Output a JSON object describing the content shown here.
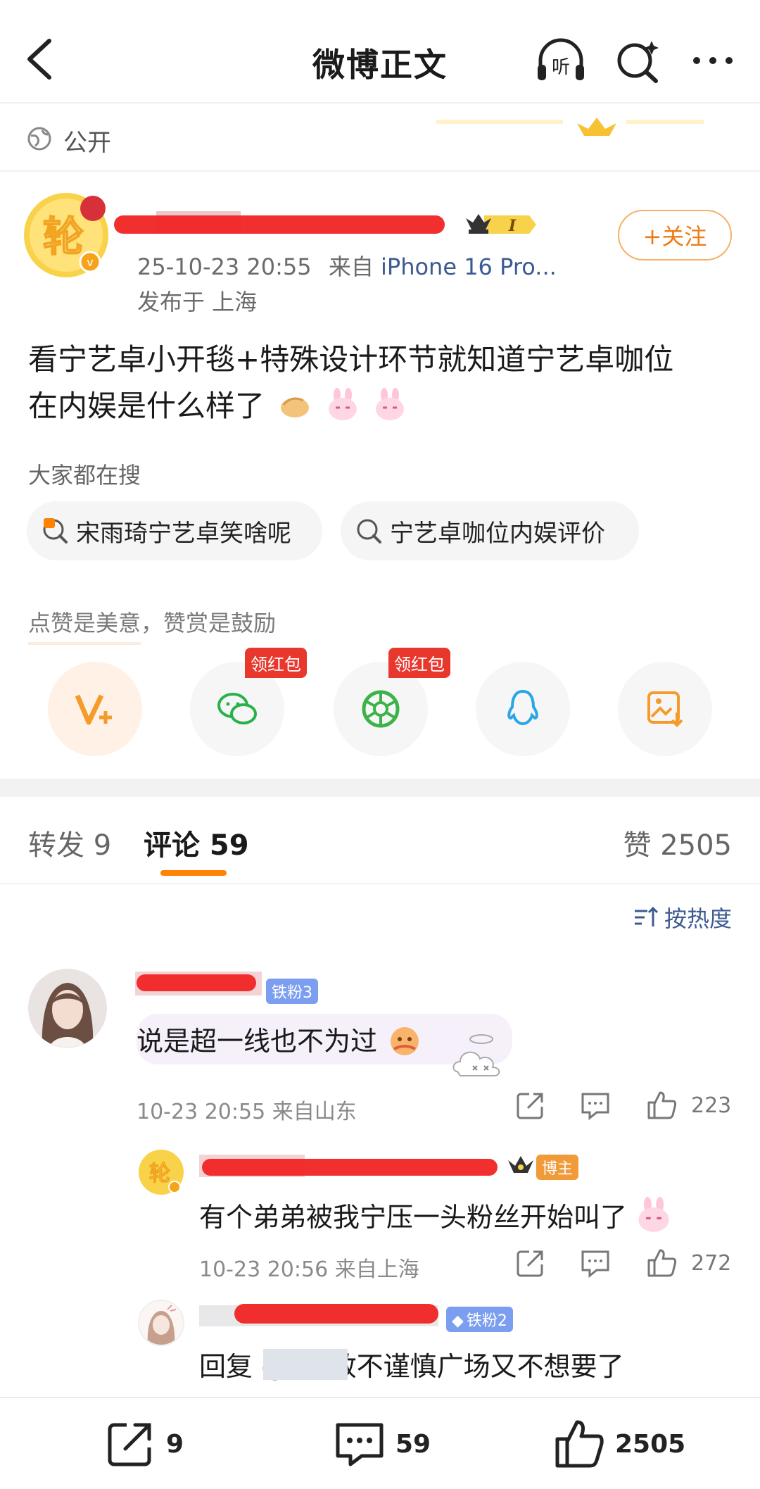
{
  "nav": {
    "title": "微博正文"
  },
  "visibility": {
    "label": "公开"
  },
  "author": {
    "timestamp": "25-10-23 20:55",
    "source_prefix": "来自",
    "source": "iPhone 16 Pro...",
    "location": "发布于 上海",
    "follow_label": "+关注",
    "level_badge": "I"
  },
  "post": {
    "text_line1": "看宁艺卓小开毯+特殊设计环节就知道宁艺卓咖位",
    "text_line2": "在内娱是什么样了"
  },
  "search": {
    "hint": "大家都在搜",
    "chip1": "宋雨琦宁艺卓笑啥呢",
    "chip2": "宁艺卓咖位内娱评价"
  },
  "reward": {
    "hint": "点赞是美意，赞赏是鼓励",
    "redpack_label": "领红包"
  },
  "tabs": {
    "repost": "转发 9",
    "comment": "评论 59",
    "like": "赞 2505"
  },
  "sort": {
    "label": "按热度"
  },
  "comments": [
    {
      "fan_badge": "铁粉3",
      "text": "说是超一线也不为过",
      "meta": "10-23 20:55 来自山东",
      "likes": "223"
    }
  ],
  "replies": [
    {
      "badge": "博主",
      "text": "有个弟弟被我宁压一头粉丝开始叫了",
      "meta": "10-23 20:56 来自上海",
      "likes": "272"
    },
    {
      "fan_badge": "铁粉2",
      "text": "回复 @        in:敢不谨慎广场又不想要了"
    }
  ],
  "bottom": {
    "repost": "9",
    "comment": "59",
    "like": "2505"
  },
  "colors": {
    "accent": "#ff8200",
    "link": "#3d5a92",
    "redact": "#f02424"
  }
}
